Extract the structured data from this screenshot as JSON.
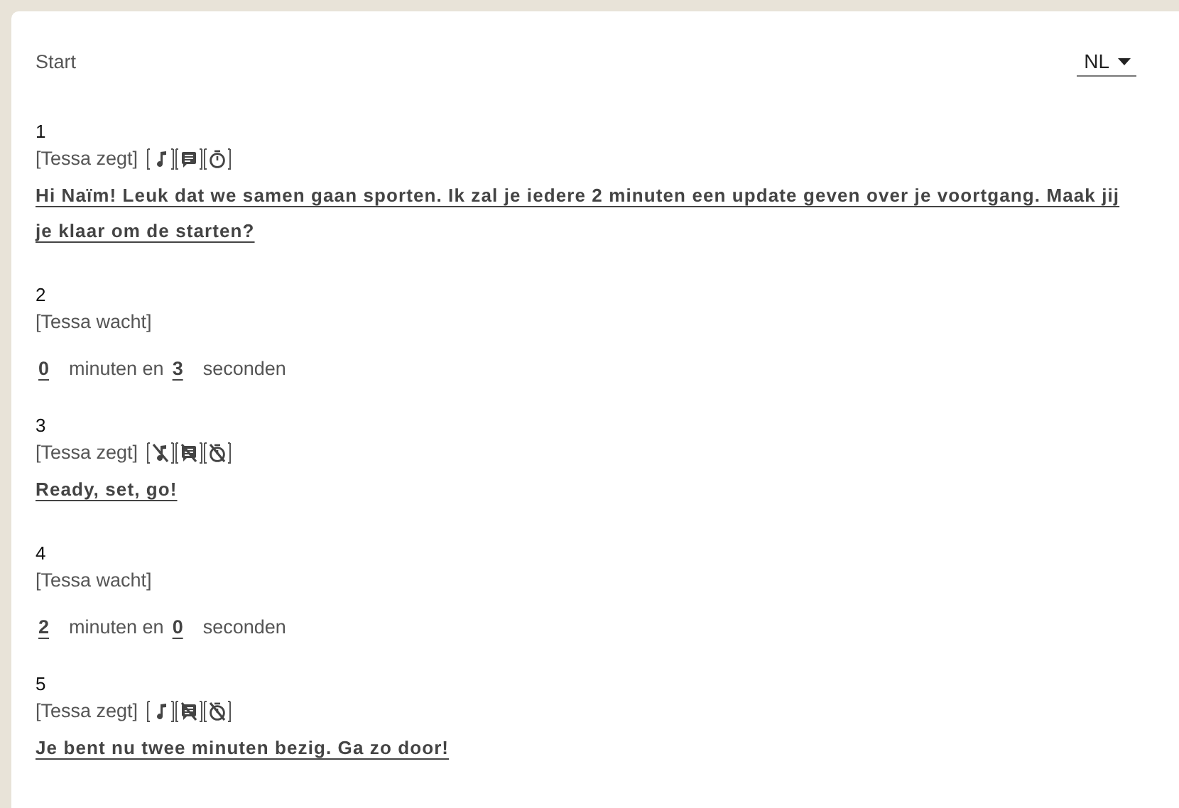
{
  "header": {
    "title": "Start",
    "language": "NL"
  },
  "steps": [
    {
      "kind": "say",
      "number": "1",
      "speaker": "[Tessa zegt]",
      "music": true,
      "chat": true,
      "timer": true,
      "message": "Hi Naïm! Leuk dat we samen gaan sporten. Ik zal je iedere 2 minuten een update geven over je voortgang. Maak jij je klaar om de starten?"
    },
    {
      "kind": "wait",
      "number": "2",
      "speaker": "[Tessa wacht]",
      "minutes": "0",
      "minutes_label": "minuten en",
      "seconds": "3",
      "seconds_label": "seconden"
    },
    {
      "kind": "say",
      "number": "3",
      "speaker": "[Tessa zegt]",
      "music": false,
      "chat": false,
      "timer": false,
      "message": "Ready, set, go!"
    },
    {
      "kind": "wait",
      "number": "4",
      "speaker": "[Tessa wacht]",
      "minutes": "2",
      "minutes_label": "minuten en",
      "seconds": "0",
      "seconds_label": "seconden"
    },
    {
      "kind": "say",
      "number": "5",
      "speaker": "[Tessa zegt]",
      "music": true,
      "chat": false,
      "timer": false,
      "message": "Je bent nu twee minuten bezig. Ga zo door!"
    }
  ]
}
